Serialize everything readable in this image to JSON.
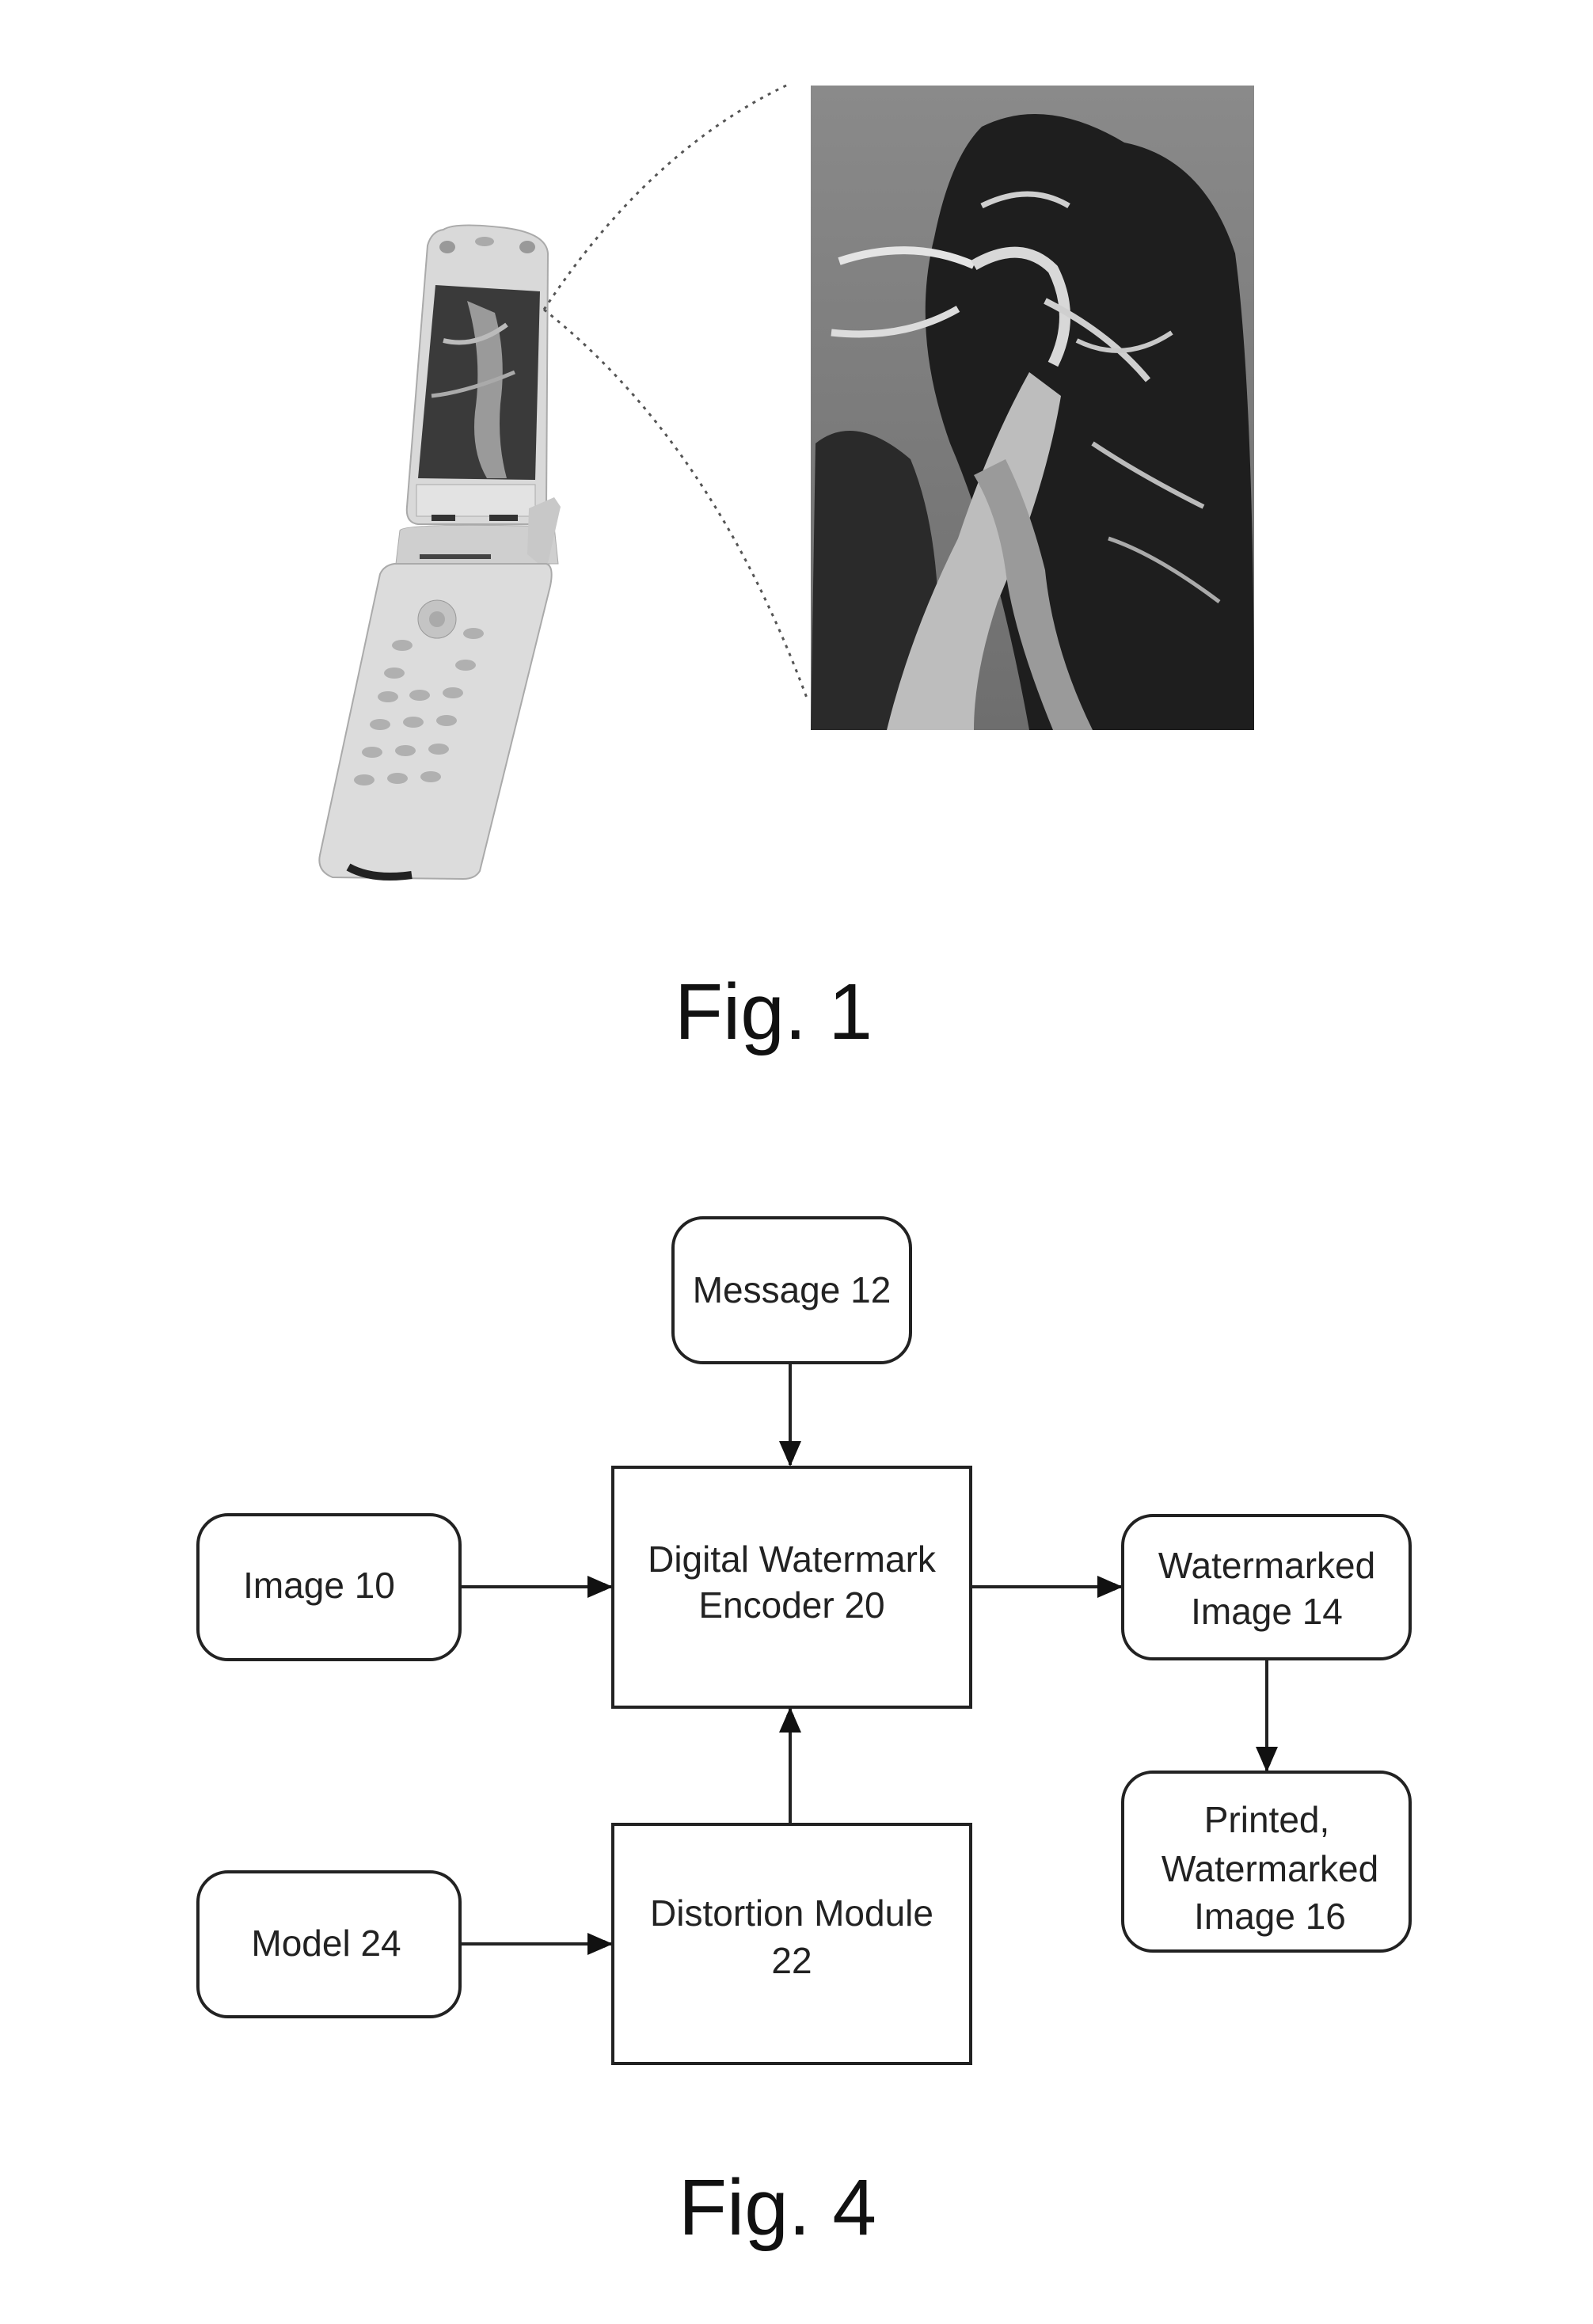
{
  "figure1": {
    "caption": "Fig. 1",
    "phone_icon": "flip-phone-photo",
    "zoomed_image_icon": "tree-photo"
  },
  "figure4": {
    "caption": "Fig. 4",
    "nodes": {
      "message": [
        "Message 12"
      ],
      "encoder": [
        "Digital Watermark",
        "Encoder 20"
      ],
      "image": [
        "Image 10"
      ],
      "watermarked": [
        "Watermarked",
        "Image 14"
      ],
      "printed": [
        "Printed,",
        "Watermarked",
        "Image 16"
      ],
      "distortion": [
        "Distortion Module",
        "22"
      ],
      "model": [
        "Model 24"
      ]
    },
    "edges": [
      {
        "from": "Message 12",
        "to": "Digital Watermark Encoder 20"
      },
      {
        "from": "Image 10",
        "to": "Digital Watermark Encoder 20"
      },
      {
        "from": "Digital Watermark Encoder 20",
        "to": "Watermarked Image 14"
      },
      {
        "from": "Watermarked Image 14",
        "to": "Printed, Watermarked Image 16"
      },
      {
        "from": "Distortion Module 22",
        "to": "Digital Watermark Encoder 20"
      },
      {
        "from": "Model 24",
        "to": "Distortion Module 22"
      }
    ]
  }
}
